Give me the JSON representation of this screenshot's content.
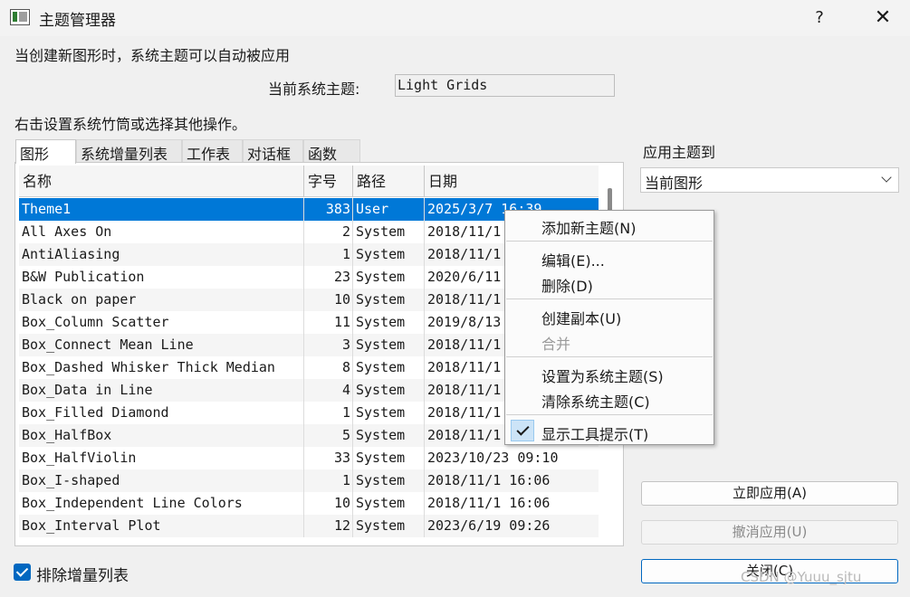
{
  "window": {
    "title": "主题管理器",
    "help": "?",
    "close": "✕"
  },
  "description": "当创建新图形时，系统主题可以自动被应用",
  "system_theme": {
    "label": "当前系统主题:",
    "value": "Light Grids"
  },
  "hint": "右击设置系统竹筒或选择其他操作。",
  "tabs": [
    "图形",
    "系统增量列表",
    "工作表",
    "对话框",
    "函数"
  ],
  "table": {
    "columns": [
      "名称",
      "字号",
      "路径",
      "日期"
    ],
    "rows": [
      {
        "name": "Theme1",
        "size": "383",
        "path": "User",
        "date": "2025/3/7 16:39"
      },
      {
        "name": "All Axes On",
        "size": "2",
        "path": "System",
        "date": "2018/11/1"
      },
      {
        "name": "AntiAliasing",
        "size": "1",
        "path": "System",
        "date": "2018/11/1"
      },
      {
        "name": "B&W Publication",
        "size": "23",
        "path": "System",
        "date": "2020/6/11"
      },
      {
        "name": "Black on paper",
        "size": "10",
        "path": "System",
        "date": "2018/11/1"
      },
      {
        "name": "Box_Column Scatter",
        "size": "11",
        "path": "System",
        "date": "2019/8/13"
      },
      {
        "name": "Box_Connect Mean Line",
        "size": "3",
        "path": "System",
        "date": "2018/11/1"
      },
      {
        "name": "Box_Dashed Whisker Thick Median",
        "size": "8",
        "path": "System",
        "date": "2018/11/1"
      },
      {
        "name": "Box_Data in Line",
        "size": "4",
        "path": "System",
        "date": "2018/11/1"
      },
      {
        "name": "Box_Filled Diamond",
        "size": "1",
        "path": "System",
        "date": "2018/11/1"
      },
      {
        "name": "Box_HalfBox",
        "size": "5",
        "path": "System",
        "date": "2018/11/1"
      },
      {
        "name": "Box_HalfViolin",
        "size": "33",
        "path": "System",
        "date": "2023/10/23 09:10"
      },
      {
        "name": "Box_I-shaped",
        "size": "1",
        "path": "System",
        "date": "2018/11/1 16:06"
      },
      {
        "name": "Box_Independent Line Colors",
        "size": "10",
        "path": "System",
        "date": "2018/11/1 16:06"
      },
      {
        "name": "Box_Interval Plot",
        "size": "12",
        "path": "System",
        "date": "2023/6/19 09:26"
      }
    ]
  },
  "apply_to": {
    "label": "应用主题到",
    "value": "当前图形"
  },
  "buttons": {
    "apply_now": "立即应用(A)",
    "undo_apply": "撤消应用(U)",
    "close": "关闭(C)"
  },
  "exclude": {
    "label": "排除增量列表",
    "checked": true
  },
  "context_menu": {
    "add_new": "添加新主题(N)",
    "edit": "编辑(E)...",
    "delete": "删除(D)",
    "duplicate": "创建副本(U)",
    "merge": "合并",
    "set_system": "设置为系统主题(S)",
    "clear_system": "清除系统主题(C)",
    "show_tooltips": "显示工具提示(T)"
  },
  "watermark": "CSDN @Yuuu_sjtu",
  "colors": {
    "selection": "#0078d7",
    "accent": "#0067c0"
  }
}
